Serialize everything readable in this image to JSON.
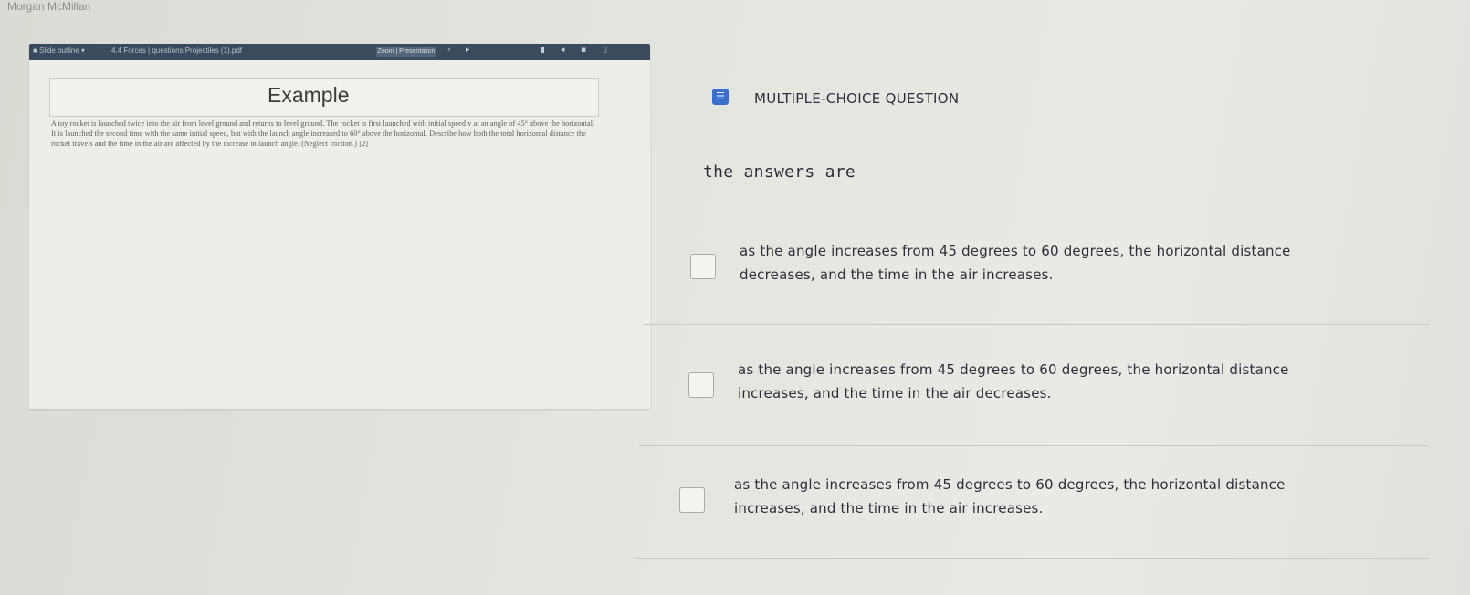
{
  "user": {
    "name": "Morgan McMillan"
  },
  "screenshot": {
    "toolbar": {
      "left_text": "■ Slide outline   ▾",
      "file_text": "4.4 Forces | questions Projectiles (1).pdf",
      "zoom_text": "Zoom | Presentation",
      "icons": [
        "nav-icon",
        "page-icon",
        "bookmark-icon",
        "share-icon",
        "print-icon",
        "download-icon"
      ]
    },
    "example_title": "Example",
    "problem_text": "A toy rocket is launched twice into the air from level ground and returns to level ground. The rocket is first launched with initial speed v at an angle of 45° above the horizontal. It is launched the second time with the same initial speed, but with the launch angle increased to 60° above the horizontal. Describe how both the total horizontal distance the rocket travels and the time in the air are affected by the increase in launch angle. (Neglect friction.) [2]"
  },
  "mcq": {
    "header_label": "MULTIPLE-CHOICE QUESTION",
    "question": "the answers are",
    "options": [
      {
        "line1": "as the angle increases from 45 degrees to 60 degrees, the horizontal distance",
        "line2": "decreases, and the time in the air increases."
      },
      {
        "line1": "as the angle increases from 45 degrees to 60 degrees, the horizontal distance",
        "line2": "increases, and the time in the air decreases."
      },
      {
        "line1": "as the angle increases from 45 degrees to 60 degrees, the horizontal distance",
        "line2": "increases, and the time in the air increases."
      }
    ]
  },
  "colors": {
    "accent": "#3a6fd0",
    "toolbar": "#3b4a5c"
  }
}
